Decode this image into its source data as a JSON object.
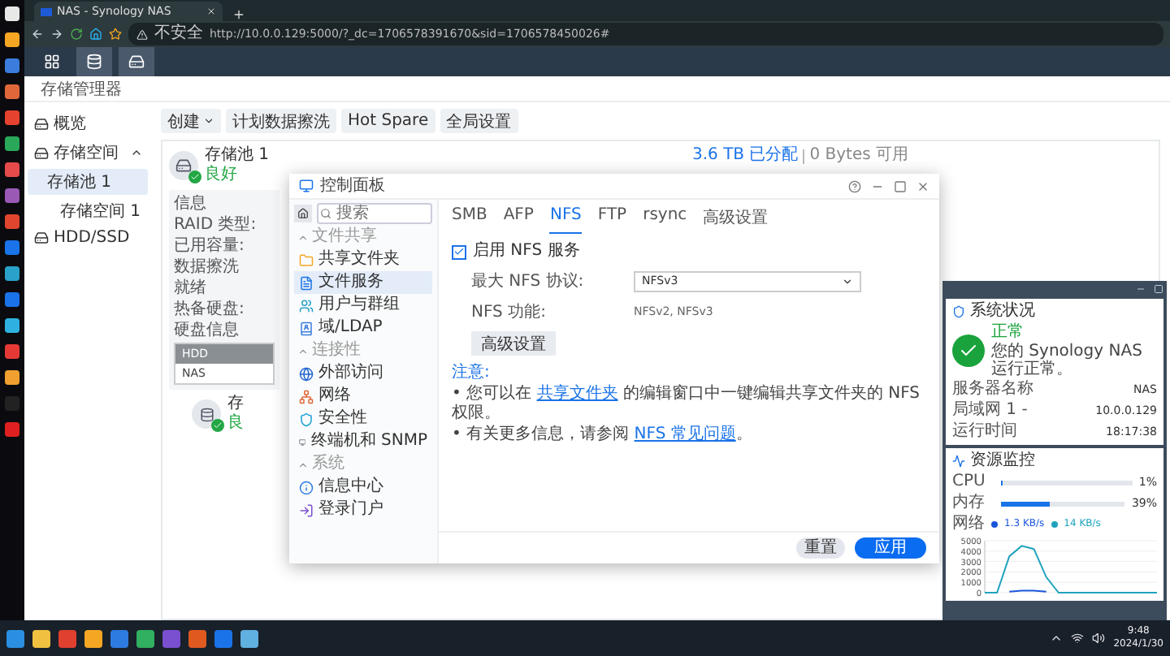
{
  "browser": {
    "tab_title": "NAS - Synology NAS",
    "security": "不安全",
    "url": "http://10.0.0.129:5000/?_dc=1706578391670&sid=1706578450026#"
  },
  "storage_manager": {
    "title": "存储管理器",
    "sidebar": [
      {
        "label": "概览",
        "selected": false
      },
      {
        "label": "存储空间",
        "selected": false,
        "expanded": true,
        "children": [
          {
            "label": "存储池 1",
            "selected": true,
            "children": [
              {
                "label": "存储空间 1",
                "selected": false
              }
            ]
          }
        ]
      },
      {
        "label": "HDD/SSD",
        "selected": false
      }
    ],
    "toolbar": [
      {
        "label": "创建",
        "kind": "dropdown"
      },
      {
        "label": "计划数据擦洗",
        "kind": "plain"
      },
      {
        "label": "Hot Spare",
        "kind": "plain"
      },
      {
        "label": "全局设置",
        "kind": "plain"
      }
    ],
    "pool": {
      "name": "存储池 1",
      "status": "良好",
      "allocated": "3.6 TB 已分配",
      "free": "0 Bytes 可用",
      "info": [
        "信息",
        "RAID 类型:",
        "已用容量:",
        "数据擦洗",
        "就绪",
        "热备硬盘:",
        "硬盘信息"
      ],
      "disk_table": [
        "HDD",
        "NAS"
      ],
      "volume": {
        "name": "存",
        "status": "良"
      }
    }
  },
  "control_panel": {
    "title": "控制面板",
    "search_placeholder": "搜索",
    "sections": [
      {
        "label": "文件共享",
        "expanded": true,
        "items": [
          {
            "label": "共享文件夹",
            "selected": false
          },
          {
            "label": "文件服务",
            "selected": true
          },
          {
            "label": "用户与群组",
            "selected": false
          },
          {
            "label": "域/LDAP",
            "selected": false
          }
        ]
      },
      {
        "label": "连接性",
        "expanded": true,
        "items": [
          {
            "label": "外部访问",
            "selected": false
          },
          {
            "label": "网络",
            "selected": false
          },
          {
            "label": "安全性",
            "selected": false
          },
          {
            "label": "终端机和 SNMP",
            "selected": false
          }
        ]
      },
      {
        "label": "系统",
        "expanded": true,
        "items": [
          {
            "label": "信息中心",
            "selected": false
          },
          {
            "label": "登录门户",
            "selected": false
          }
        ]
      }
    ],
    "tabs": [
      {
        "label": "SMB",
        "selected": false
      },
      {
        "label": "AFP",
        "selected": false
      },
      {
        "label": "NFS",
        "selected": true
      },
      {
        "label": "FTP",
        "selected": false
      },
      {
        "label": "rsync",
        "selected": false
      },
      {
        "label": "高级设置",
        "selected": false
      }
    ],
    "enable_nfs": {
      "label": "启用 NFS 服务",
      "checked": true
    },
    "max_protocol": {
      "label": "最大 NFS 协议:",
      "value": "NFSv3"
    },
    "features": {
      "label": "NFS 功能:",
      "value": "NFSv2, NFSv3"
    },
    "advanced_button": "高级设置",
    "note_title": "注意:",
    "notes": [
      [
        {
          "text": "• 您可以在 "
        },
        {
          "link": "共享文件夹"
        },
        {
          "text": " 的编辑窗口中一键编辑共享文件夹的 NFS 权限。"
        }
      ],
      [
        {
          "text": "• 有关更多信息，请参阅 "
        },
        {
          "link": "NFS 常见问题"
        },
        {
          "text": "。"
        }
      ]
    ],
    "buttons": [
      {
        "label": "重置",
        "kind": "secondary"
      },
      {
        "label": "应用",
        "kind": "primary"
      }
    ]
  },
  "widgets": {
    "health": {
      "title": "系统状况",
      "status": "正常",
      "message": "您的 Synology NAS 运行正常。",
      "rows": [
        {
          "label": "服务器名称",
          "value": "NAS"
        },
        {
          "label": "局域网 1 -",
          "value": "10.0.0.129"
        },
        {
          "label": "运行时间",
          "value": "18:17:38"
        }
      ]
    },
    "resource": {
      "title": "资源监控",
      "meters": [
        {
          "label": "CPU",
          "level": 0.01,
          "reading": "1%"
        },
        {
          "label": "内存",
          "level": 0.39,
          "reading": "39%"
        }
      ],
      "network": {
        "label": "网络",
        "upload": "1.3 KB/s",
        "download": "14 KB/s"
      },
      "chart_data": {
        "type": "line",
        "ylim": [
          0,
          5000
        ],
        "yticks": [
          0,
          1000,
          2000,
          3000,
          4000,
          5000
        ],
        "grid": true,
        "series": [
          {
            "color": "#1a56db",
            "values": [
              null,
              null,
              100,
              200,
              200,
              100,
              null,
              null,
              null,
              null,
              null,
              null,
              null,
              null,
              null
            ]
          },
          {
            "color": "#1fa3bd",
            "values": [
              0,
              0,
              3500,
              4500,
              4200,
              1500,
              0,
              0,
              0,
              0,
              0,
              0,
              0,
              0,
              0
            ]
          }
        ]
      }
    }
  },
  "taskbar": {
    "time": "9:48",
    "date": "2024/1/30"
  }
}
